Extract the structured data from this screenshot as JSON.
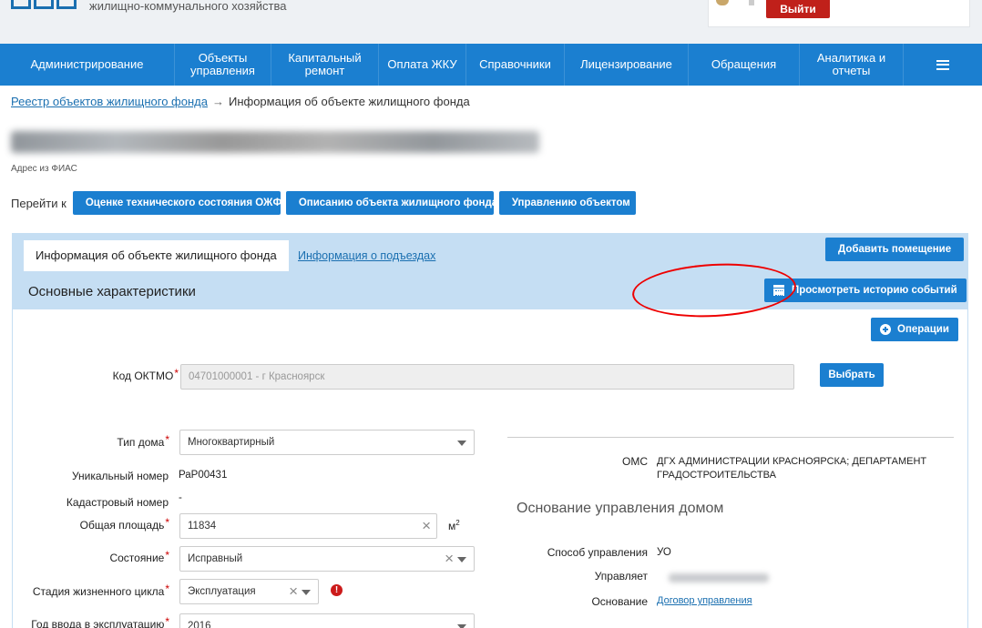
{
  "header": {
    "subtitle": "жилищно-коммунального хозяйства",
    "logout_label": "Выйти"
  },
  "nav": {
    "items": [
      {
        "label": "Администрирование"
      },
      {
        "label": "Объекты управления"
      },
      {
        "label": "Капитальный ремонт"
      },
      {
        "label": "Оплата ЖКУ"
      },
      {
        "label": "Справочники"
      },
      {
        "label": "Лицензирование"
      },
      {
        "label": "Обращения"
      },
      {
        "label": "Аналитика и отчеты"
      }
    ]
  },
  "breadcrumb": {
    "parent": "Реестр объектов жилищного фонда",
    "current": "Информация об объекте жилищного фонда"
  },
  "address": {
    "caption": "Адрес из ФИАС"
  },
  "goto": {
    "label": "Перейти к",
    "buttons": [
      "Оценке технического состояния ОЖФ",
      "Описанию объекта жилищного фонда",
      "Управлению объектом"
    ]
  },
  "panel": {
    "tab_active": "Информация об объекте жилищного фонда",
    "tab_link": "Информация о подъездах",
    "add_room_label": "Добавить помещение",
    "title": "Основные характеристики",
    "history_label": "Просмотреть историю событий",
    "operations_label": "Операции"
  },
  "form": {
    "oktmo_label": "Код ОКТМО",
    "oktmo_value": "04701000001 - г Красноярск",
    "choose_label": "Выбрать",
    "house_type_label": "Тип дома",
    "house_type_value": "Многоквартирный",
    "unique_no_label": "Уникальный номер",
    "unique_no_value": "РаР00431",
    "cadastral_label": "Кадастровый номер",
    "cadastral_value": "-",
    "area_label": "Общая площадь",
    "area_value": "11834",
    "area_unit": "м",
    "area_unit_sup": "2",
    "state_label": "Состояние",
    "state_value": "Исправный",
    "lifecycle_label": "Стадия жизненного цикла",
    "lifecycle_value": "Эксплуатация",
    "year_label": "Год ввода в эксплуатацию",
    "year_value": "2016",
    "clear_symbol": "×",
    "warn_symbol": "!"
  },
  "right": {
    "oms_label": "ОМС",
    "oms_value": "ДГХ АДМИНИСТРАЦИИ КРАСНОЯРСКА; ДЕПАРТАМЕНТ ГРАДОСТРОИТЕЛЬСТВА",
    "section_title": "Основание управления домом",
    "method_label": "Способ управления",
    "method_value": "УО",
    "manages_label": "Управляет",
    "basis_label": "Основание",
    "basis_link": "Договор управления"
  },
  "colors": {
    "nav_bg": "#1b7fd0",
    "panel_head_bg": "#c5def3",
    "logout_bg": "#c0201a",
    "required": "#cc0000",
    "annotation": "#ee0000"
  }
}
